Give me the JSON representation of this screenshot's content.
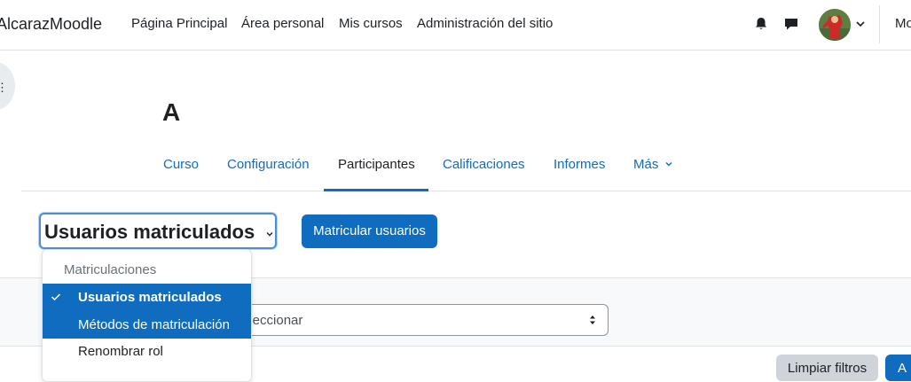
{
  "navbar": {
    "brand": "AlcarazMoodle",
    "links": [
      "Página Principal",
      "Área personal",
      "Mis cursos",
      "Administración del sitio"
    ],
    "notifications_icon": "bell-icon",
    "messages_icon": "chat-bubble-icon",
    "user_menu_icon": "chevron-down-icon",
    "language": "Mo"
  },
  "drawer": {
    "toggle_icon": "kebab-icon",
    "toggle_glyph": "⋮"
  },
  "course": {
    "title": "A"
  },
  "secondary_nav": {
    "tabs": [
      {
        "label": "Curso"
      },
      {
        "label": "Configuración"
      },
      {
        "label": "Participantes"
      },
      {
        "label": "Calificaciones"
      },
      {
        "label": "Informes"
      },
      {
        "label": "Más"
      }
    ],
    "active_tab": "Participantes",
    "more_icon": "chevron-down-icon"
  },
  "participants": {
    "page_select_value": "Usuarios matriculados",
    "enrol_button": "Matricular usuarios",
    "dropdown": {
      "group_label": "Matriculaciones",
      "items": [
        {
          "label": "Usuarios matriculados",
          "selected": true
        },
        {
          "label": "Métodos de matriculación",
          "selected": false
        },
        {
          "label": "Renombrar rol",
          "selected": false
        }
      ]
    },
    "filter_select_text": "eleccionar",
    "clear_filters_button": "Limpiar filtros",
    "apply_filters_button": "A"
  },
  "colors": {
    "primary": "#0f6cbf",
    "text": "#1d2125",
    "muted": "#6a737b",
    "border": "#dee2e6",
    "secondary_button": "#ced4da"
  }
}
